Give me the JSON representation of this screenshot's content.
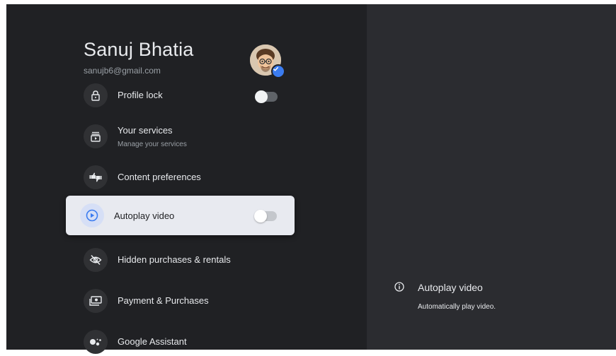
{
  "profile": {
    "name": "Sanuj Bhatia",
    "email": "sanujb6@gmail.com"
  },
  "menu": {
    "items": [
      {
        "label": "Profile lock",
        "icon": "lock-icon",
        "toggle": true,
        "toggle_on": false
      },
      {
        "label": "Your services",
        "sublabel": "Manage your services",
        "icon": "services-icon"
      },
      {
        "label": "Content preferences",
        "icon": "thumbs-icon"
      },
      {
        "label": "Autoplay video",
        "icon": "play-circle-icon",
        "toggle": true,
        "toggle_on": false,
        "focused": true
      },
      {
        "label": "Hidden purchases & rentals",
        "icon": "eye-off-icon"
      },
      {
        "label": "Payment & Purchases",
        "icon": "payment-icon"
      },
      {
        "label": "Google Assistant",
        "icon": "assistant-icon"
      }
    ]
  },
  "info": {
    "title": "Autoplay video",
    "description": "Automatically play video.",
    "icon": "info-icon"
  },
  "colors": {
    "background": "#202124",
    "panel": "#2b2c30",
    "focused_card": "#e8eaf0",
    "accent": "#3b7cf0",
    "text": "#e8eaed",
    "subtext": "#9aa0a6"
  }
}
